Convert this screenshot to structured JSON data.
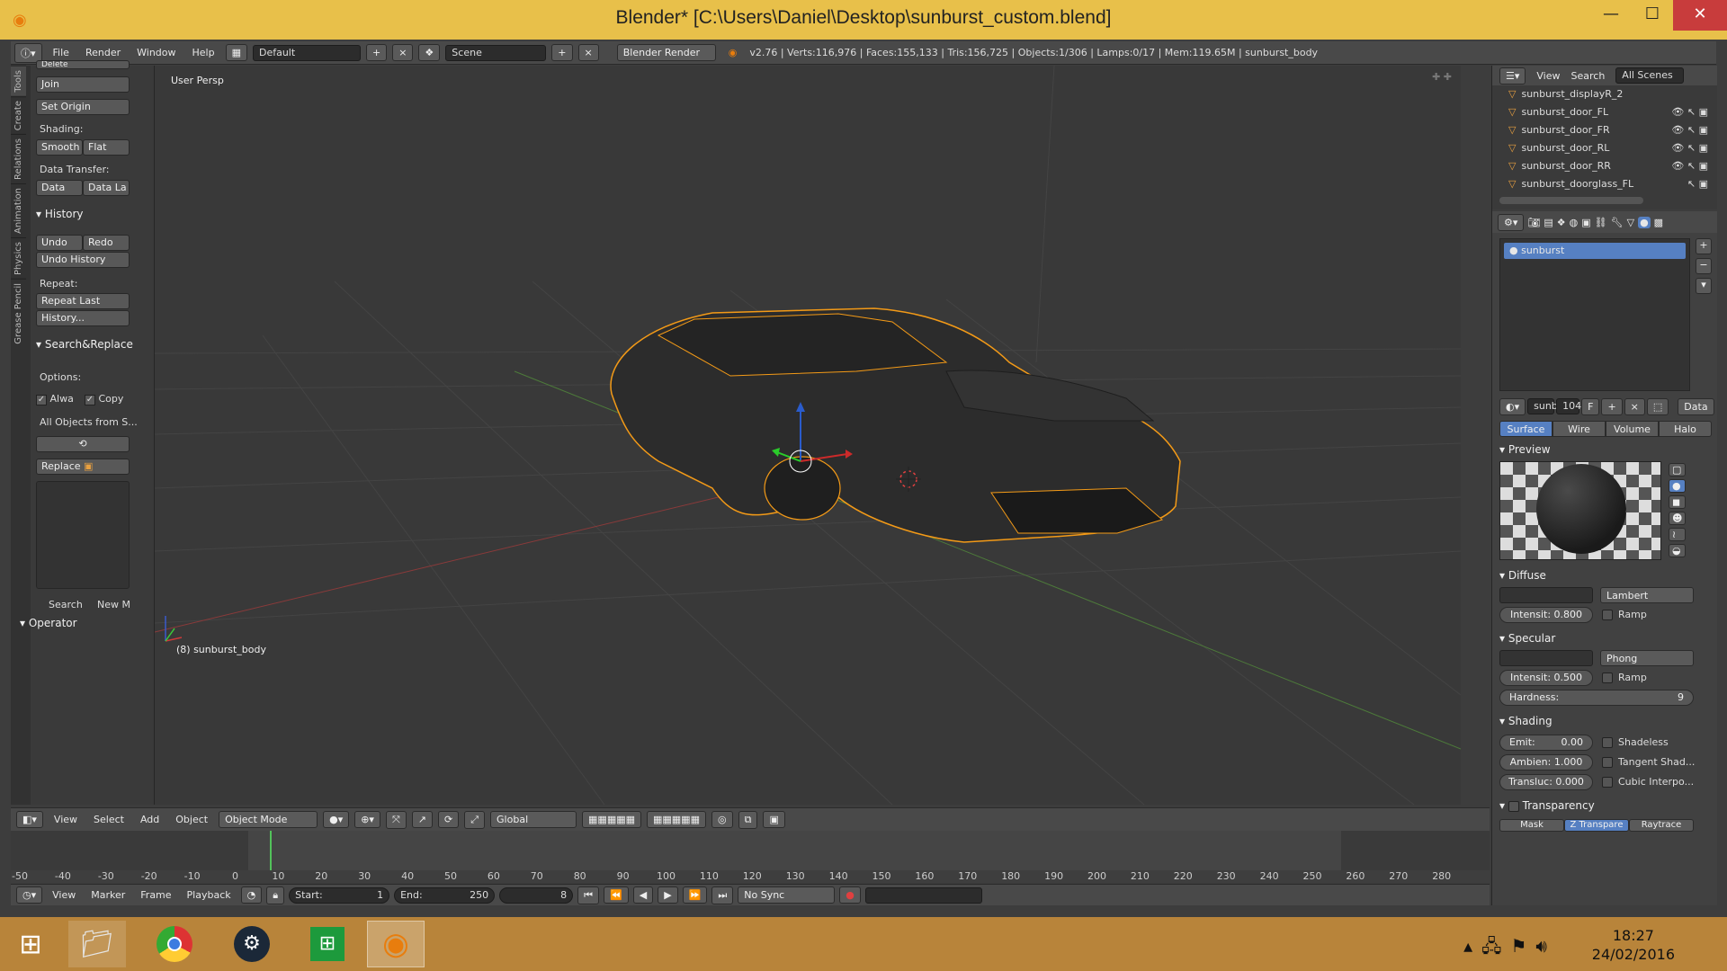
{
  "window": {
    "title": "Blender* [C:\\Users\\Daniel\\Desktop\\sunburst_custom.blend]",
    "minimize": "—",
    "maximize": "☐",
    "close": "✕"
  },
  "topbar": {
    "menus": [
      "File",
      "Render",
      "Window",
      "Help"
    ],
    "layout": "Default",
    "scene": "Scene",
    "engine": "Blender Render",
    "stats": "v2.76 | Verts:116,976 | Faces:155,133 | Tris:156,725 | Objects:1/306 | Lamps:0/17 | Mem:119.65M | sunburst_body"
  },
  "tool_shelf": {
    "tabs": [
      "Tools",
      "Create",
      "Relations",
      "Animation",
      "Physics",
      "Grease Pencil"
    ],
    "cut_top": "Delete",
    "join": "Join",
    "set_origin": "Set Origin",
    "shading_label": "Shading:",
    "smooth": "Smooth",
    "flat": "Flat",
    "data_transfer_label": "Data Transfer:",
    "data": "Data",
    "data_la": "Data La",
    "history_header": "History",
    "undo": "Undo",
    "redo": "Redo",
    "undo_history": "Undo History",
    "repeat_label": "Repeat:",
    "repeat_last": "Repeat Last",
    "history_dots": "History...",
    "search_replace_header": "Search&Replace",
    "options_label": "Options:",
    "alwa": "Alwa",
    "copy": "Copy",
    "all_objects": "All Objects from S...",
    "replace": "Replace",
    "search": "Search",
    "new_m": "New M",
    "operator_header": "Operator"
  },
  "viewport": {
    "persp_label": "User Persp",
    "object_label": "(8) sunburst_body"
  },
  "view3d_header": {
    "menus": [
      "View",
      "Select",
      "Add",
      "Object"
    ],
    "mode": "Object Mode",
    "orientation": "Global"
  },
  "timeline": {
    "ticks": [
      "-50",
      "-40",
      "-30",
      "-20",
      "-10",
      "0",
      "10",
      "20",
      "30",
      "40",
      "50",
      "60",
      "70",
      "80",
      "90",
      "100",
      "110",
      "120",
      "130",
      "140",
      "150",
      "160",
      "170",
      "180",
      "190",
      "200",
      "210",
      "220",
      "230",
      "240",
      "250",
      "260",
      "270",
      "280"
    ],
    "menus": [
      "View",
      "Marker",
      "Frame",
      "Playback"
    ],
    "start_label": "Start:",
    "start": "1",
    "end_label": "End:",
    "end": "250",
    "current": "8",
    "sync": "No Sync",
    "current_frame_value": 8
  },
  "outliner": {
    "view": "View",
    "search": "Search",
    "scenes": "All Scenes",
    "items": [
      "sunburst_displayR_2",
      "sunburst_door_FL",
      "sunburst_door_FR",
      "sunburst_door_RL",
      "sunburst_door_RR",
      "sunburst_doorglass_FL"
    ]
  },
  "properties": {
    "material_slot": "sunburst",
    "mat_name": "sunb",
    "users": "104",
    "f": "F",
    "data": "Data",
    "tabs": [
      "Surface",
      "Wire",
      "Volume",
      "Halo"
    ],
    "preview_header": "Preview",
    "diffuse_header": "Diffuse",
    "diffuse_shader": "Lambert",
    "diffuse_intensity": "Intensit: 0.800",
    "ramp": "Ramp",
    "specular_header": "Specular",
    "specular_shader": "Phong",
    "specular_intensity": "Intensit: 0.500",
    "hardness_label": "Hardness:",
    "hardness": "9",
    "shading_header": "Shading",
    "emit": "Emit:",
    "emit_val": "0.00",
    "ambient": "Ambien: 1.000",
    "translucency": "Transluc: 0.000",
    "shadeless": "Shadeless",
    "tangent": "Tangent Shad...",
    "cubic": "Cubic Interpo...",
    "transparency_header": "Transparency",
    "t_tabs": [
      "Mask",
      "Z Transpare",
      "Raytrace"
    ]
  },
  "taskbar": {
    "time": "18:27",
    "date": "24/02/2016"
  },
  "colors": {
    "title_bg": "#e8c04a",
    "selection": "#f39a17",
    "active_tab": "#5680c2",
    "taskbar": "#b8843a"
  }
}
